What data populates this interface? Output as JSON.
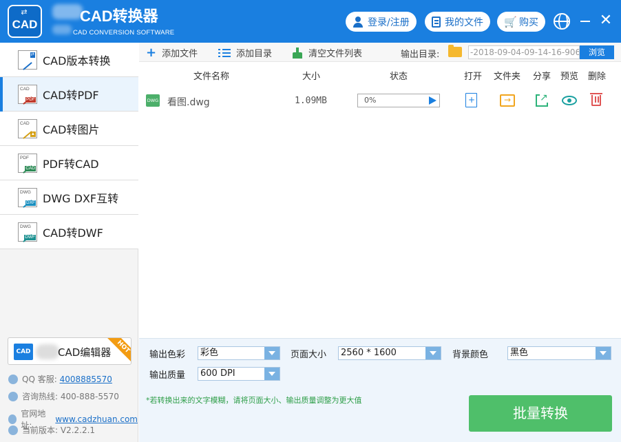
{
  "titlebar": {
    "logo_text": "CAD",
    "title": "CAD转换器",
    "subtitle": "CAD CONVERSION SOFTWARE",
    "login_label": "登录/注册",
    "myfiles_label": "我的文件",
    "buy_label": "购买",
    "icons": [
      "user-icon",
      "document-icon",
      "cart-icon",
      "globe-icon",
      "minimize-icon",
      "close-icon"
    ]
  },
  "sidebar": {
    "items": [
      {
        "label": "CAD版本转换",
        "icon": "cad-version-icon"
      },
      {
        "label": "CAD转PDF",
        "icon": "cad-to-pdf-icon",
        "active": true
      },
      {
        "label": "CAD转图片",
        "icon": "cad-to-image-icon"
      },
      {
        "label": "PDF转CAD",
        "icon": "pdf-to-cad-icon"
      },
      {
        "label": "DWG DXF互转",
        "icon": "dwg-dxf-icon"
      },
      {
        "label": "CAD转DWF",
        "icon": "cad-to-dwf-icon"
      }
    ],
    "editor": {
      "label": "CAD编辑器",
      "badge": "HOT",
      "mini_text": "CAD"
    },
    "info": {
      "qq_label": "QQ 客服:",
      "qq_value": "4008885570",
      "hotline_label": "咨询热线:",
      "hotline_value": "400-888-5570",
      "site_label": "官网地址:",
      "site_value": "www.cadzhuan.com",
      "version_label": "当前版本:",
      "version_value": "V2.2.2.1"
    }
  },
  "toolbar": {
    "add_file": "添加文件",
    "add_dir": "添加目录",
    "clear_list": "清空文件列表",
    "output_dir_label": "输出目录:",
    "output_dir_value": "-2018-09-04-09-14-16-906",
    "browse": "浏览"
  },
  "table": {
    "headers": {
      "name": "文件名称",
      "size": "大小",
      "status": "状态",
      "open": "打开",
      "folder": "文件夹",
      "share": "分享",
      "preview": "预览",
      "delete": "删除"
    },
    "rows": [
      {
        "file_type": "DWG",
        "name": "看图.dwg",
        "size": "1.09MB",
        "progress_text": "0%",
        "progress": 0.0
      }
    ]
  },
  "settings": {
    "color_label": "输出色彩",
    "color_value": "彩色",
    "page_size_label": "页面大小",
    "page_size_value": "2560 * 1600",
    "bg_color_label": "背景颜色",
    "bg_color_value": "黑色",
    "quality_label": "输出质量",
    "quality_value": "600 DPI",
    "note": "*若转换出来的文字模糊，请将页面大小、输出质量调整为更大值",
    "convert_button": "批量转换"
  },
  "colors": {
    "brand_blue": "#1a7fe0",
    "convert_green": "#4fbf6a",
    "hot_orange": "#f39c12"
  }
}
